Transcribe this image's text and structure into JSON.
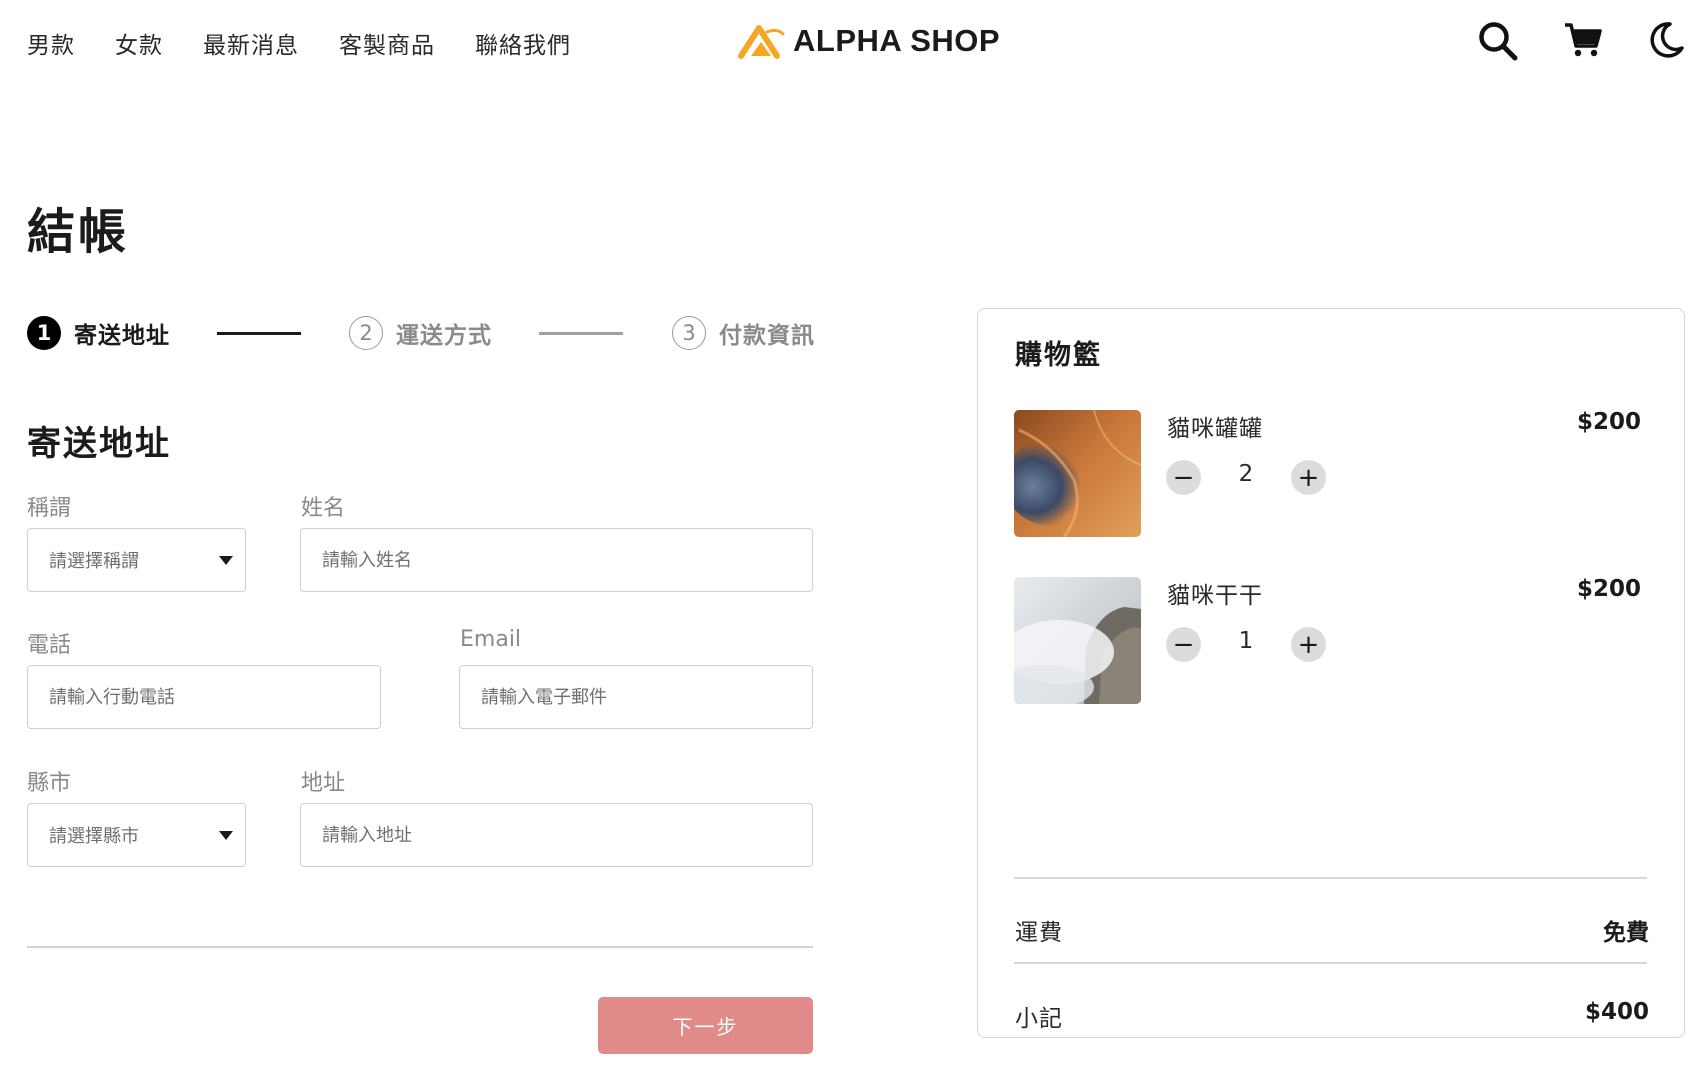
{
  "nav": {
    "items": [
      "男款",
      "女款",
      "最新消息",
      "客製商品",
      "聯絡我們"
    ]
  },
  "brand": {
    "name": "ALPHA SHOP",
    "logo_icon": "mountain-logo-icon",
    "accent": "#f5a623"
  },
  "header_icons": [
    "search-icon",
    "cart-icon",
    "moon-icon"
  ],
  "page": {
    "title": "結帳"
  },
  "stepper": {
    "steps": [
      {
        "number": "1",
        "label": "寄送地址",
        "active": true
      },
      {
        "number": "2",
        "label": "運送方式",
        "active": false
      },
      {
        "number": "3",
        "label": "付款資訊",
        "active": false
      }
    ]
  },
  "form": {
    "section_title": "寄送地址",
    "salutation": {
      "label": "稱謂",
      "value": "請選擇稱謂"
    },
    "name": {
      "label": "姓名",
      "placeholder": "請輸入姓名"
    },
    "phone": {
      "label": "電話",
      "placeholder": "請輸入行動電話"
    },
    "email": {
      "label": "Email",
      "placeholder": "請輸入電子郵件"
    },
    "city": {
      "label": "縣市",
      "value": "請選擇縣市"
    },
    "address": {
      "label": "地址",
      "placeholder": "請輸入地址"
    },
    "next_button": "下一步",
    "next_button_color": "#e08a8a"
  },
  "cart": {
    "title": "購物籃",
    "items": [
      {
        "name": "貓咪罐罐",
        "price": "$200",
        "quantity": "2"
      },
      {
        "name": "貓咪干干",
        "price": "$200",
        "quantity": "1"
      }
    ],
    "shipping": {
      "label": "運費",
      "value": "免費"
    },
    "subtotal": {
      "label": "小記",
      "value": "$400"
    }
  }
}
